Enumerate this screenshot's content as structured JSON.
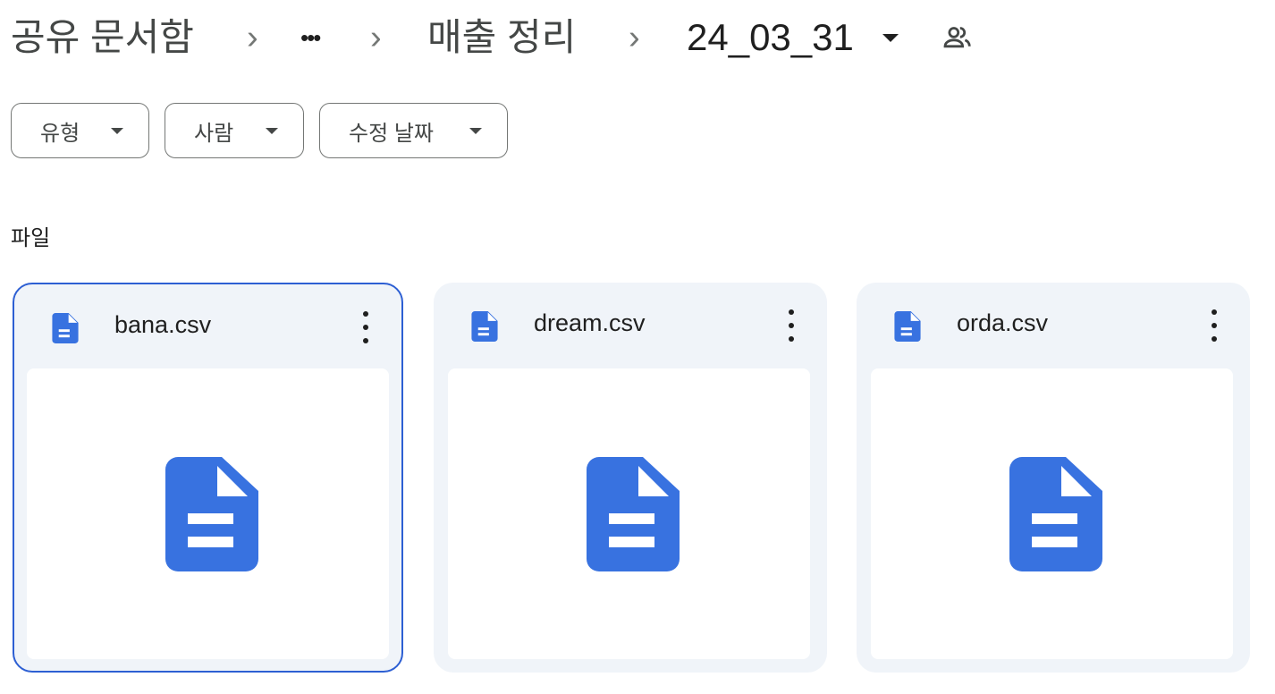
{
  "breadcrumb": {
    "items": [
      "공유 문서함",
      "•••",
      "매출 정리",
      "24_03_31"
    ],
    "separator": "›"
  },
  "filters": [
    {
      "label": "유형"
    },
    {
      "label": "사람"
    },
    {
      "label": "수정 날짜"
    }
  ],
  "section_title": "파일",
  "files": [
    {
      "name": "bana.csv",
      "selected": true
    },
    {
      "name": "dream.csv"
    },
    {
      "name": "orda.csv"
    }
  ],
  "colors": {
    "accent": "#3872e0",
    "selection": "#2d5fd3",
    "card_bg": "#f0f4f9"
  }
}
